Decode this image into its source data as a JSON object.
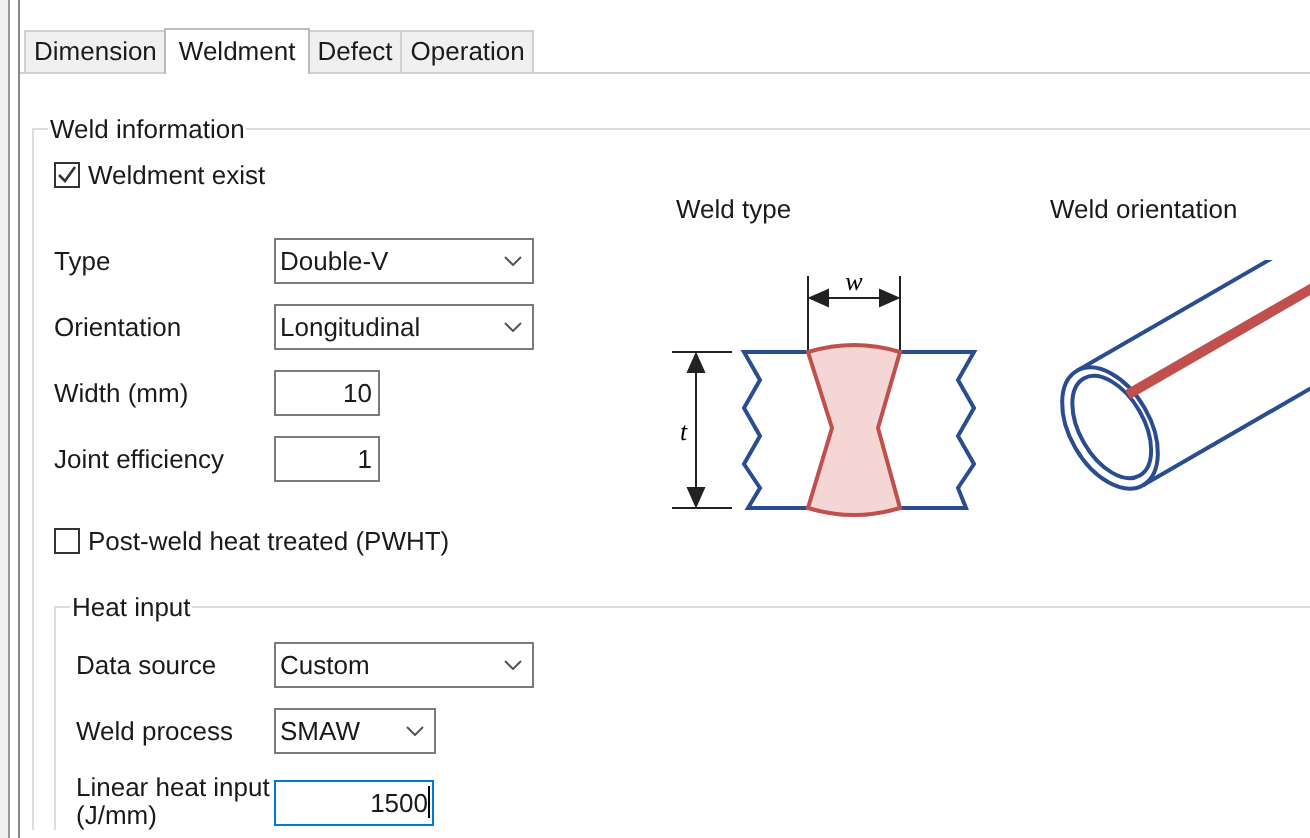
{
  "tabs": [
    {
      "label": "Dimension",
      "selected": false
    },
    {
      "label": "Weldment",
      "selected": true
    },
    {
      "label": "Defect",
      "selected": false
    },
    {
      "label": "Operation",
      "selected": false
    }
  ],
  "weld_information": {
    "title": "Weld information",
    "weldment_exist": {
      "label": "Weldment exist",
      "checked": true
    },
    "fields": [
      {
        "kind": "dropdown",
        "label": "Type",
        "value": "Double-V"
      },
      {
        "kind": "dropdown",
        "label": "Orientation",
        "value": "Longitudinal"
      },
      {
        "kind": "number",
        "label": "Width (mm)",
        "value": "10"
      },
      {
        "kind": "number",
        "label": "Joint efficiency",
        "value": "1"
      }
    ],
    "pwht": {
      "label": "Post-weld heat treated (PWHT)",
      "checked": false
    },
    "weld_type": {
      "title": "Weld type",
      "width_symbol": "w",
      "thickness_symbol": "t"
    },
    "weld_orientation": {
      "title": "Weld orientation"
    }
  },
  "heat_input": {
    "title": "Heat input",
    "fields": [
      {
        "kind": "dropdown",
        "label": "Data source",
        "value": "Custom"
      },
      {
        "kind": "dropdown",
        "label": "Weld process",
        "value": "SMAW"
      },
      {
        "kind": "number",
        "label": "Linear heat input (J/mm)",
        "value": "1500",
        "focused": true
      }
    ]
  }
}
